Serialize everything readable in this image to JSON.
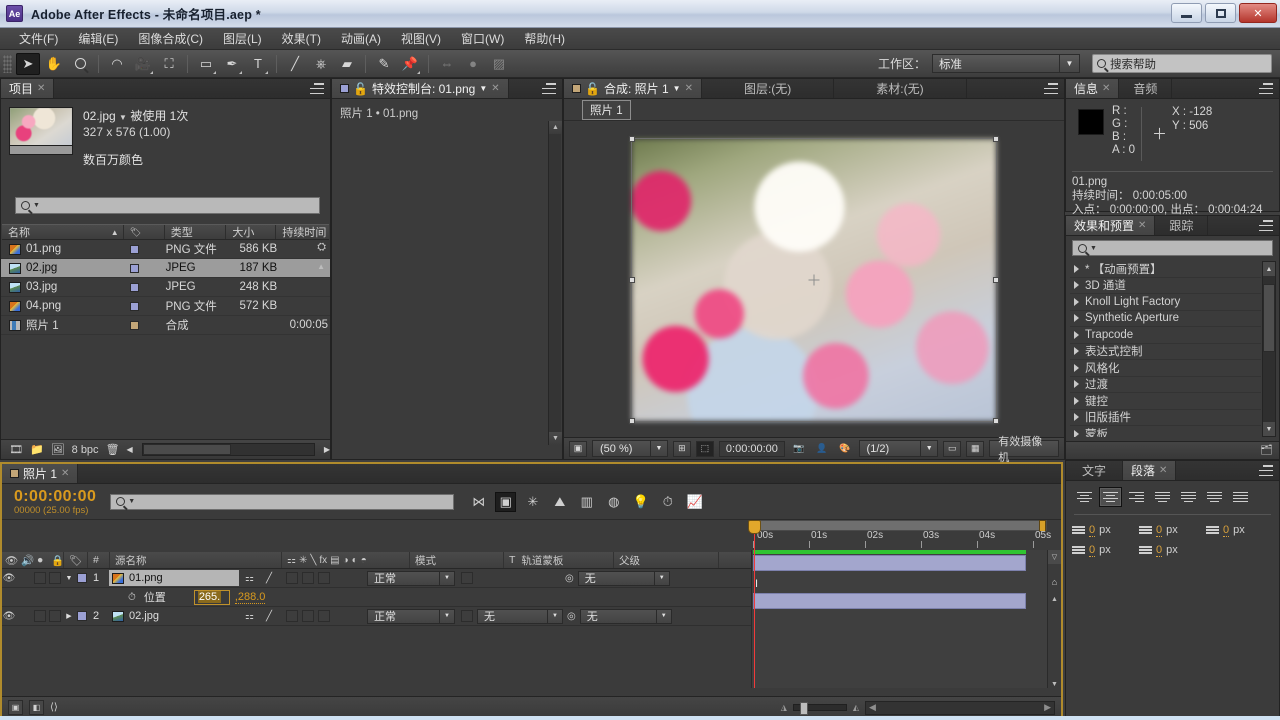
{
  "window": {
    "app_badge": "Ae",
    "title": "Adobe After Effects - 未命名项目.aep *",
    "minimize": "—",
    "maximize": "❐",
    "close": "✕"
  },
  "menu": [
    {
      "label": "文件(F)"
    },
    {
      "label": "编辑(E)"
    },
    {
      "label": "图像合成(C)"
    },
    {
      "label": "图层(L)"
    },
    {
      "label": "效果(T)"
    },
    {
      "label": "动画(A)"
    },
    {
      "label": "视图(V)"
    },
    {
      "label": "窗口(W)"
    },
    {
      "label": "帮助(H)"
    }
  ],
  "toolbar": {
    "workspace_label": "工作区：",
    "workspace_value": "标准",
    "help_placeholder": "搜索帮助"
  },
  "project": {
    "tab": "项目",
    "selected_asset": {
      "name": "02.jpg",
      "usage": "被使用 1次",
      "dimensions": "327 x 576 (1.00)",
      "color_depth": "数百万颜色"
    },
    "columns": [
      "名称",
      "类型",
      "大小",
      "持续时间"
    ],
    "rows": [
      {
        "name": "01.png",
        "type": "PNG 文件",
        "size": "586 KB",
        "duration": "",
        "icon": "png",
        "swatch": "asset",
        "selected": false
      },
      {
        "name": "02.jpg",
        "type": "JPEG",
        "size": "187 KB",
        "duration": "",
        "icon": "jpg",
        "swatch": "asset",
        "selected": true
      },
      {
        "name": "03.jpg",
        "type": "JPEG",
        "size": "248 KB",
        "duration": "",
        "icon": "jpg",
        "swatch": "asset",
        "selected": false
      },
      {
        "name": "04.png",
        "type": "PNG 文件",
        "size": "572 KB",
        "duration": "",
        "icon": "png",
        "swatch": "asset",
        "selected": false
      },
      {
        "name": "照片 1",
        "type": "合成",
        "size": "",
        "duration": "0:00:05",
        "icon": "comp",
        "swatch": "comp",
        "selected": false
      }
    ],
    "footer_bpc": "8 bpc"
  },
  "effect_controls": {
    "tab": "特效控制台: 01.png",
    "breadcrumb": "照片 1 • 01.png"
  },
  "composition": {
    "tab": "合成: 照片 1",
    "tab_layer": "图层:(无)",
    "tab_footage": "素材:(无)",
    "breadcrumb": "照片 1",
    "footer": {
      "magnification": "(50 %)",
      "time": "0:00:00:00",
      "resolution": "(1/2)",
      "camera": "有效摄像机"
    }
  },
  "info": {
    "tab": "信息",
    "tab_audio": "音频",
    "r": "R :",
    "g": "G :",
    "b": "B :",
    "a": "A : 0",
    "x": "X : -128",
    "y": "Y : 506",
    "file": "01.png",
    "duration": "持续时间： 0:00:05:00",
    "inout": "入点： 0:00:00:00, 出点： 0:00:04:24"
  },
  "effects_presets": {
    "tab": "效果和预置",
    "tab_tracking": "跟踪",
    "items": [
      "* 【动画预置】",
      "3D 通道",
      "Knoll Light Factory",
      "Synthetic Aperture",
      "Trapcode",
      "表达式控制",
      "风格化",
      "过渡",
      "键控",
      "旧版插件",
      "蒙板"
    ]
  },
  "paragraph": {
    "tab_text": "文字",
    "tab": "段落",
    "indents": [
      {
        "value": "0",
        "unit": "px"
      },
      {
        "value": "0",
        "unit": "px"
      },
      {
        "value": "0",
        "unit": "px"
      },
      {
        "value": "0",
        "unit": "px"
      },
      {
        "value": "0",
        "unit": "px"
      }
    ]
  },
  "timeline": {
    "tab": "照片 1",
    "current_time": "0:00:00:00",
    "frame_info": "00000 (25.00 fps)",
    "columns": [
      "源名称",
      "模式",
      "轨道蒙板",
      "父级"
    ],
    "col_hash": "#",
    "col_t": "T",
    "layers": [
      {
        "index": "1",
        "name": "01.png",
        "mode": "正常",
        "trkmat": "",
        "parent": "无",
        "selected": true,
        "expanded": true,
        "properties": [
          {
            "name": "位置",
            "value_edit": "265.",
            "value_rest": ",288.0"
          }
        ]
      },
      {
        "index": "2",
        "name": "02.jpg",
        "mode": "正常",
        "trkmat": "无",
        "parent": "无",
        "selected": false,
        "expanded": false,
        "properties": []
      }
    ],
    "ruler_labels": [
      "00s",
      "01s",
      "02s",
      "03s",
      "04s",
      "05s"
    ]
  },
  "colors": {
    "accent_orange": "#d99a1e",
    "panel_bg": "#3b3b3b",
    "selection_gray": "#9c9c9c",
    "playhead_red": "#f13a3a",
    "render_green": "#2fc432",
    "clip_purple": "#a3a6cd"
  }
}
